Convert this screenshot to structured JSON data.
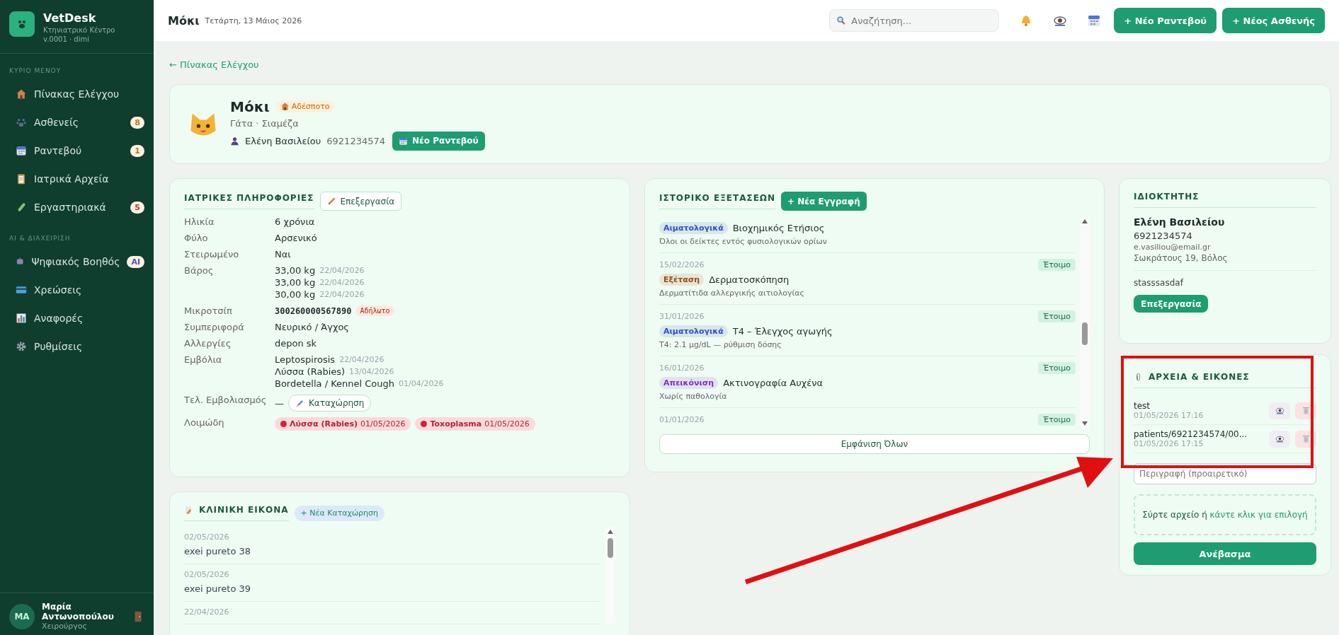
{
  "brand": {
    "name": "VetDesk",
    "subtitle": "Κτηνιατρικό Κέντρο",
    "version": "v.0001 · dimi"
  },
  "sidebar": {
    "sections": [
      {
        "title": "ΚΥΡΙΟ ΜΕΝΟΥ",
        "items": [
          {
            "label": "Πίνακας Ελέγχου",
            "selected": false
          },
          {
            "label": "Ασθενείς",
            "selected": false,
            "badge": "8",
            "color": "#b7791f"
          },
          {
            "label": "Ραντεβού",
            "selected": false,
            "badge": "1",
            "color": "#b7791f"
          },
          {
            "label": "Ιατρικά Αρχεία",
            "selected": false
          },
          {
            "label": "Εργαστηριακά",
            "selected": false,
            "badge": "5",
            "color": "#c53030"
          }
        ]
      },
      {
        "title": "AI & ΔΙΑΧΕΙΡΙΣΗ",
        "items": [
          {
            "label": "Ψηφιακός Βοηθός",
            "selected": false,
            "badge": "AI",
            "color": "#5b4bc4"
          },
          {
            "label": "Χρεώσεις",
            "selected": false
          },
          {
            "label": "Αναφορές",
            "selected": false
          },
          {
            "label": "Ρυθμίσεις",
            "selected": false
          }
        ]
      }
    ],
    "user": {
      "initials": "MA",
      "name": "Μαρία Αντωνοπούλου",
      "role": "Χειρούργος"
    }
  },
  "header": {
    "title": "Μόκι",
    "date": "Τετάρτη, 13 Μάιος 2026",
    "search_placeholder": "Αναζήτηση...",
    "buttons": [
      "+ Νέο Ραντεβού",
      "+ Νέος Ασθενής"
    ]
  },
  "back_link": "← Πίνακας Ελέγχου",
  "patient": {
    "name": "Μόκι",
    "status": "Αδέσποτο",
    "species": "Γάτα · Σιαμέζα",
    "owner": "Ελένη Βασιλείου",
    "phone": "6921234574",
    "button": "Νέο Ραντεβού"
  },
  "medical_info": {
    "title": "ΙΑΤΡΙΚΕΣ ΠΛΗΡΟΦΟΡΙΕΣ",
    "edit": "Επεξεργασία",
    "rows": [
      {
        "kind": "text",
        "label": "Ηλικία",
        "value": "6 χρόνια"
      },
      {
        "kind": "text",
        "label": "Φύλο",
        "value": "Αρσενικό"
      },
      {
        "kind": "text",
        "label": "Στειρωμένο",
        "value": "Ναι"
      },
      {
        "kind": "list",
        "label": "Βάρος",
        "entries": [
          {
            "value": "33,00 kg",
            "date": "22/04/2026"
          },
          {
            "value": "33,00 kg",
            "date": "22/04/2026"
          },
          {
            "value": "30,00 kg",
            "date": "22/04/2026"
          }
        ]
      },
      {
        "kind": "chip",
        "label": "Μικροτσίπ",
        "value": "300260000567890",
        "tag": "Αδήλωτο"
      },
      {
        "kind": "text",
        "label": "Συμπεριφορά",
        "value": "Νευρικό / Άγχος"
      },
      {
        "kind": "text",
        "label": "Αλλεργίες",
        "value": "depon sk"
      },
      {
        "kind": "list",
        "label": "Εμβόλια",
        "entries": [
          {
            "value": "Leptospirosis",
            "date": "22/04/2026"
          },
          {
            "value": "Λύσσα (Rabies)",
            "date": "13/04/2026"
          },
          {
            "value": "Bordetella / Kennel Cough",
            "date": "01/04/2026"
          }
        ]
      },
      {
        "kind": "action",
        "label": "Τελ. Εμβολιασμός",
        "value": "—",
        "button": "Καταχώρηση"
      },
      {
        "kind": "alerts",
        "label": "Λοιμώδη",
        "entries": [
          {
            "value": "Λύσσα (Rabies)",
            "date": "01/05/2026"
          },
          {
            "value": "Toxoplasma",
            "date": "01/05/2026"
          }
        ]
      }
    ]
  },
  "clinical": {
    "title": "ΚΛΙΝΙΚΗ ΕΙΚΟΝΑ",
    "button": "+ Νέα Καταχώρηση",
    "entries": [
      {
        "date": "02/05/2026",
        "text": "exei pureto 38"
      },
      {
        "date": "02/05/2026",
        "text": "exei pureto 39"
      },
      {
        "date": "22/04/2026"
      }
    ]
  },
  "exams": {
    "title": "ΙΣΤΟΡΙΚΟ ΕΞΕΤΑΣΕΩΝ",
    "button": "+ Νέα Εγγραφή",
    "show_all": "Εμφάνιση Όλων",
    "items": [
      {
        "tag": "Αιματολογικά",
        "color": "#2b4fc9",
        "title": "Βιοχημικός Ετήσιος",
        "note": "Όλοι οι δείκτες εντός φυσιολογικών ορίων"
      },
      {
        "date": "15/02/2026",
        "status": "Έτοιμο",
        "tag": "Εξέταση",
        "color": "#9c4a12",
        "title": "Δερματοσκόπηση",
        "note": "Δερματίτιδα αλλεργικής αιτιολογίας"
      },
      {
        "date": "31/01/2026",
        "status": "Έτοιμο",
        "tag": "Αιματολογικά",
        "color": "#2b4fc9",
        "title": "T4 – Έλεγχος αγωγής",
        "note": "T4: 2.1 μg/dL — ρύθμιση δόσης"
      },
      {
        "date": "16/01/2026",
        "status": "Έτοιμο",
        "tag": "Απεικόνιση",
        "color": "#7e2fc4",
        "title": "Ακτινογραφία Αυχένα",
        "note": "Χωρίς παθολογία"
      },
      {
        "date": "01/01/2026",
        "status": "Έτοιμο"
      }
    ]
  },
  "owner": {
    "title": "ΙΔΙΟΚΤΗΤΗΣ",
    "name": "Ελένη Βασιλείου",
    "phone": "6921234574",
    "email": "e.vasiliou@email.gr",
    "address": "Σωκράτους 19, Βόλος",
    "note": "stasssasdaf",
    "edit": "Επεξεργασία"
  },
  "files": {
    "title": "ΑΡΧΕΙΑ & ΕΙΚΟΝΕΣ",
    "items": [
      {
        "name": "test",
        "date": "01/05/2026 17:16"
      },
      {
        "name": "patients/6921234574/00...",
        "date": "01/05/2026 17:15"
      }
    ],
    "description_placeholder": "Περιγραφή (προαιρετικό)",
    "drop_text": "Σύρτε αρχείο ή",
    "drop_link": "κάντε κλικ για επιλογή",
    "upload": "Ανέβασμα"
  }
}
